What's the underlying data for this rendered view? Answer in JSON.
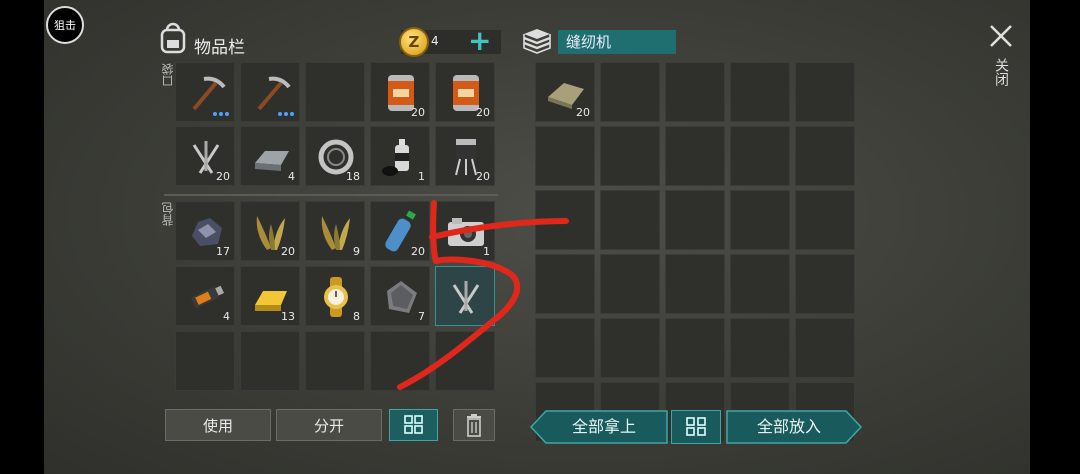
{
  "top_left_button": "狙击",
  "inventory": {
    "title": "物品栏",
    "currency_value": "4",
    "add_symbol": "+",
    "pocket_label": "口袋",
    "backpack_label": "背包",
    "slots": [
      {
        "item": "pickaxe-icon",
        "qty": "",
        "dots": true,
        "red_tick": true
      },
      {
        "item": "pickaxe-icon",
        "qty": "",
        "dots": true,
        "red_tick": false
      },
      {
        "item": "",
        "qty": ""
      },
      {
        "item": "food-can-icon",
        "qty": "20"
      },
      {
        "item": "food-can-icon",
        "qty": "20"
      },
      {
        "item": "nails-icon",
        "qty": "20"
      },
      {
        "item": "metal-ingot-icon",
        "qty": "4"
      },
      {
        "item": "bearing-icon",
        "qty": "18"
      },
      {
        "item": "spray-can-icon",
        "qty": "1"
      },
      {
        "item": "transistor-icon",
        "qty": "20"
      },
      {
        "item": "coal-icon",
        "qty": "17"
      },
      {
        "item": "grass-icon",
        "qty": "20"
      },
      {
        "item": "grass-icon",
        "qty": "9"
      },
      {
        "item": "water-bottle-icon",
        "qty": "20"
      },
      {
        "item": "camera-icon",
        "qty": "1"
      },
      {
        "item": "usb-drive-icon",
        "qty": "4"
      },
      {
        "item": "gold-bar-icon",
        "qty": "13"
      },
      {
        "item": "gold-watch-icon",
        "qty": "8"
      },
      {
        "item": "metal-plate-icon",
        "qty": "7"
      },
      {
        "item": "nails-icon",
        "qty": "",
        "selected": true
      },
      {
        "item": "",
        "qty": ""
      },
      {
        "item": "",
        "qty": ""
      },
      {
        "item": "",
        "qty": ""
      },
      {
        "item": "",
        "qty": ""
      },
      {
        "item": "",
        "qty": ""
      }
    ]
  },
  "buttons": {
    "use": "使用",
    "split": "分开",
    "take_all": "全部拿上",
    "put_all": "全部放入",
    "close_label": "关闭"
  },
  "crafting": {
    "title": "缝纫机",
    "first_item": {
      "item": "cloth-icon",
      "qty": "20"
    }
  },
  "colors": {
    "accent": "#1f6f70",
    "annotation": "#e0271c"
  }
}
